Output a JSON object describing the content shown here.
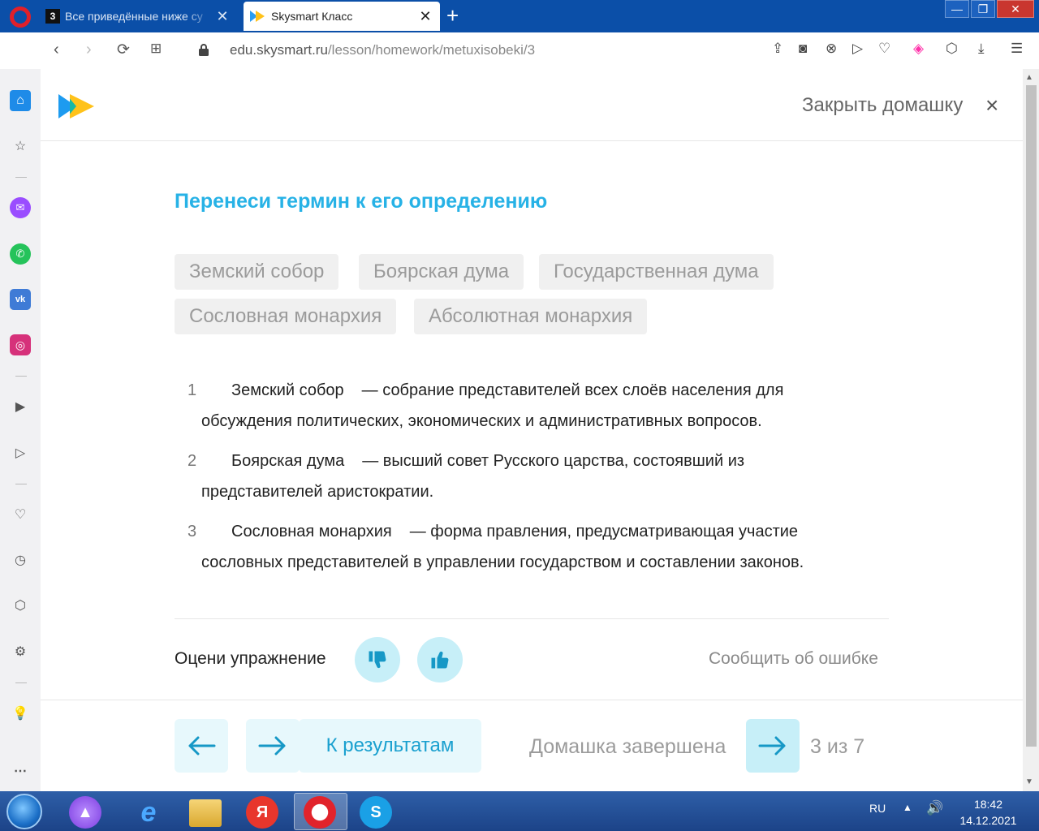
{
  "browser": {
    "tabs": [
      {
        "favicon": "3",
        "title": "Все приведённые ниже су"
      },
      {
        "title": "Skysmart Класс"
      }
    ],
    "url_host": "edu.skysmart.ru",
    "url_path": "/lesson/homework/metuxisobeki/3"
  },
  "header": {
    "close_label": "Закрыть домашку",
    "close_icon": "×"
  },
  "task": {
    "title": "Перенеси термин к его определению",
    "terms": [
      "Земский собор",
      "Боярская дума",
      "Государственная дума",
      "Сословная монархия",
      "Абсолютная монархия"
    ],
    "items": [
      {
        "num": "1",
        "term": "Земский собор",
        "line1": "— собрание представителей всех слоёв населения для",
        "line2": "обсуждения политических, экономических и административных вопросов."
      },
      {
        "num": "2",
        "term": "Боярская дума",
        "line1": "— высший совет Русского царства, состоявший из",
        "line2": "представителей аристократии."
      },
      {
        "num": "3",
        "term": "Сословная монархия",
        "line1": "— форма правления, предусматривающая участие",
        "line2": "сословных представителей в управлении государством и составлении законов."
      }
    ]
  },
  "rating": {
    "label": "Оцени упражнение",
    "report": "Сообщить об ошибке"
  },
  "footer": {
    "results": "К результатам",
    "done": "Домашка завершена",
    "counter": "3 из 7"
  },
  "taskbar": {
    "lang": "RU",
    "time": "18:42",
    "date": "14.12.2021"
  },
  "colors": {
    "accent": "#27b2e6",
    "button_bg": "#e7f8fc",
    "button_bg_strong": "#c7eff8"
  }
}
